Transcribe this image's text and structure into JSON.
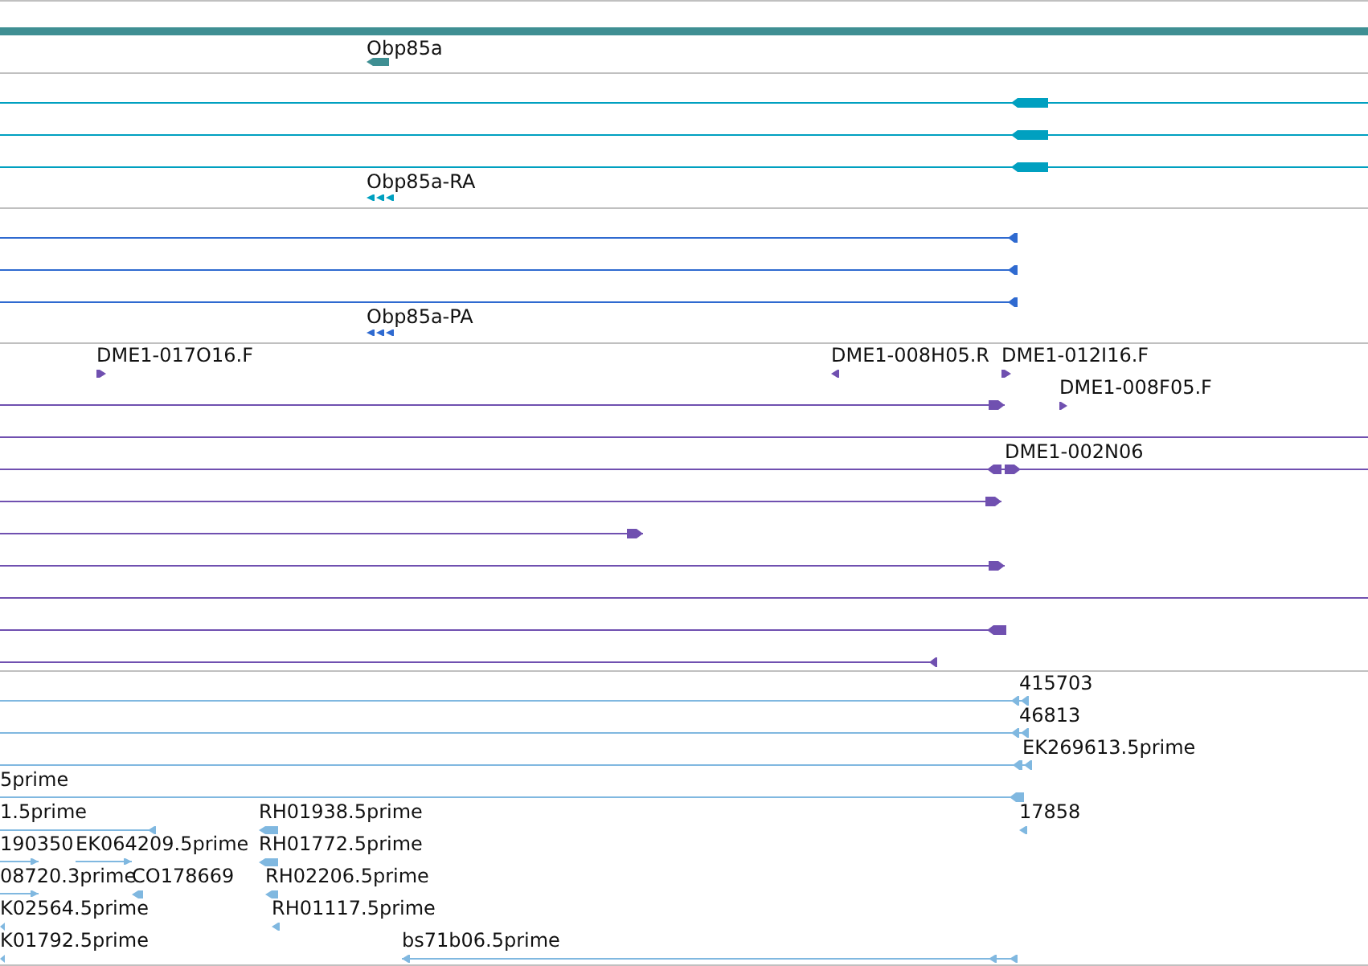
{
  "tracks": [
    {
      "color": "#3f8f93",
      "features": [
        {
          "kind": "plain"
        },
        {
          "label": "Obp85a",
          "kind": "reverse"
        }
      ]
    },
    {
      "color": "#00a0c0",
      "features": [
        {
          "kind": "reverse"
        },
        {
          "kind": "reverse"
        },
        {
          "kind": "reverse"
        },
        {
          "label": "Obp85a-RA",
          "kind": "reverse"
        }
      ]
    },
    {
      "color": "#2f6ad0",
      "features": [
        {
          "kind": "reverse"
        },
        {
          "kind": "reverse"
        },
        {
          "kind": "reverse"
        },
        {
          "label": "Obp85a-PA",
          "kind": "reverse"
        }
      ]
    },
    {
      "color": "#7050b0",
      "features": [
        {
          "label": "DME1-017O16.F",
          "kind": "forward"
        },
        {
          "label": "DME1-008H05.R",
          "kind": "reverse"
        },
        {
          "label": "DME1-012I16.F",
          "kind": "forward"
        },
        {
          "kind": "forward"
        },
        {
          "label": "DME1-008F05.F",
          "kind": "forward"
        },
        {
          "kind": "plain"
        },
        {
          "label": "DME1-002N06",
          "kind": "forward"
        },
        {
          "kind": "forward"
        },
        {
          "kind": "forward"
        },
        {
          "kind": "forward"
        },
        {
          "kind": "plain"
        },
        {
          "kind": "reverse"
        },
        {
          "kind": "reverse"
        }
      ]
    },
    {
      "color": "#80b8e0",
      "features": [
        {
          "label": "415703",
          "kind": "reverse"
        },
        {
          "label": "46813",
          "kind": "reverse"
        },
        {
          "label": "EK269613.5prime",
          "kind": "reverse"
        },
        {
          "label": "5prime",
          "kind": "reverse"
        },
        {
          "label": "1.5prime",
          "kind": "reverse"
        },
        {
          "label": "RH01938.5prime",
          "kind": "reverse"
        },
        {
          "label": "17858",
          "kind": "reverse"
        },
        {
          "label": "190350",
          "kind": "forward"
        },
        {
          "label": "EK064209.5prime",
          "kind": "forward"
        },
        {
          "label": "RH01772.5prime",
          "kind": "reverse"
        },
        {
          "label": "08720.3prime",
          "kind": "forward"
        },
        {
          "label": "CO178669",
          "kind": "reverse"
        },
        {
          "label": "RH02206.5prime",
          "kind": "reverse"
        },
        {
          "label": "K02564.5prime",
          "kind": "reverse"
        },
        {
          "label": "RH01117.5prime",
          "kind": "reverse"
        },
        {
          "label": "K01792.5prime",
          "kind": "reverse"
        },
        {
          "label": "bs71b06.5prime",
          "kind": "reverse"
        }
      ]
    }
  ]
}
